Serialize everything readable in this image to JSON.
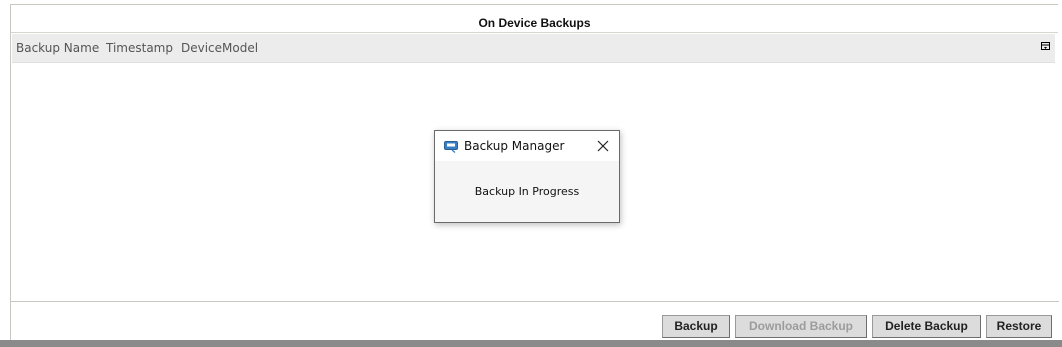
{
  "panel": {
    "title": "On Device Backups"
  },
  "table": {
    "columns": [
      "Backup Name",
      "Timestamp",
      "DeviceModel"
    ],
    "column_menu_icon": "column-chooser-icon",
    "rows": []
  },
  "buttons": {
    "backup": "Backup",
    "download_backup": "Download Backup",
    "delete_backup": "Delete Backup",
    "restore": "Restore"
  },
  "dialog": {
    "title": "Backup Manager",
    "message": "Backup In Progress",
    "app_icon": "backup-manager-app-icon",
    "close_icon": "close-icon"
  },
  "colors": {
    "header_bg": "#ececec",
    "button_bg": "#dcdcdc",
    "disabled_text": "#9c9c9c"
  }
}
